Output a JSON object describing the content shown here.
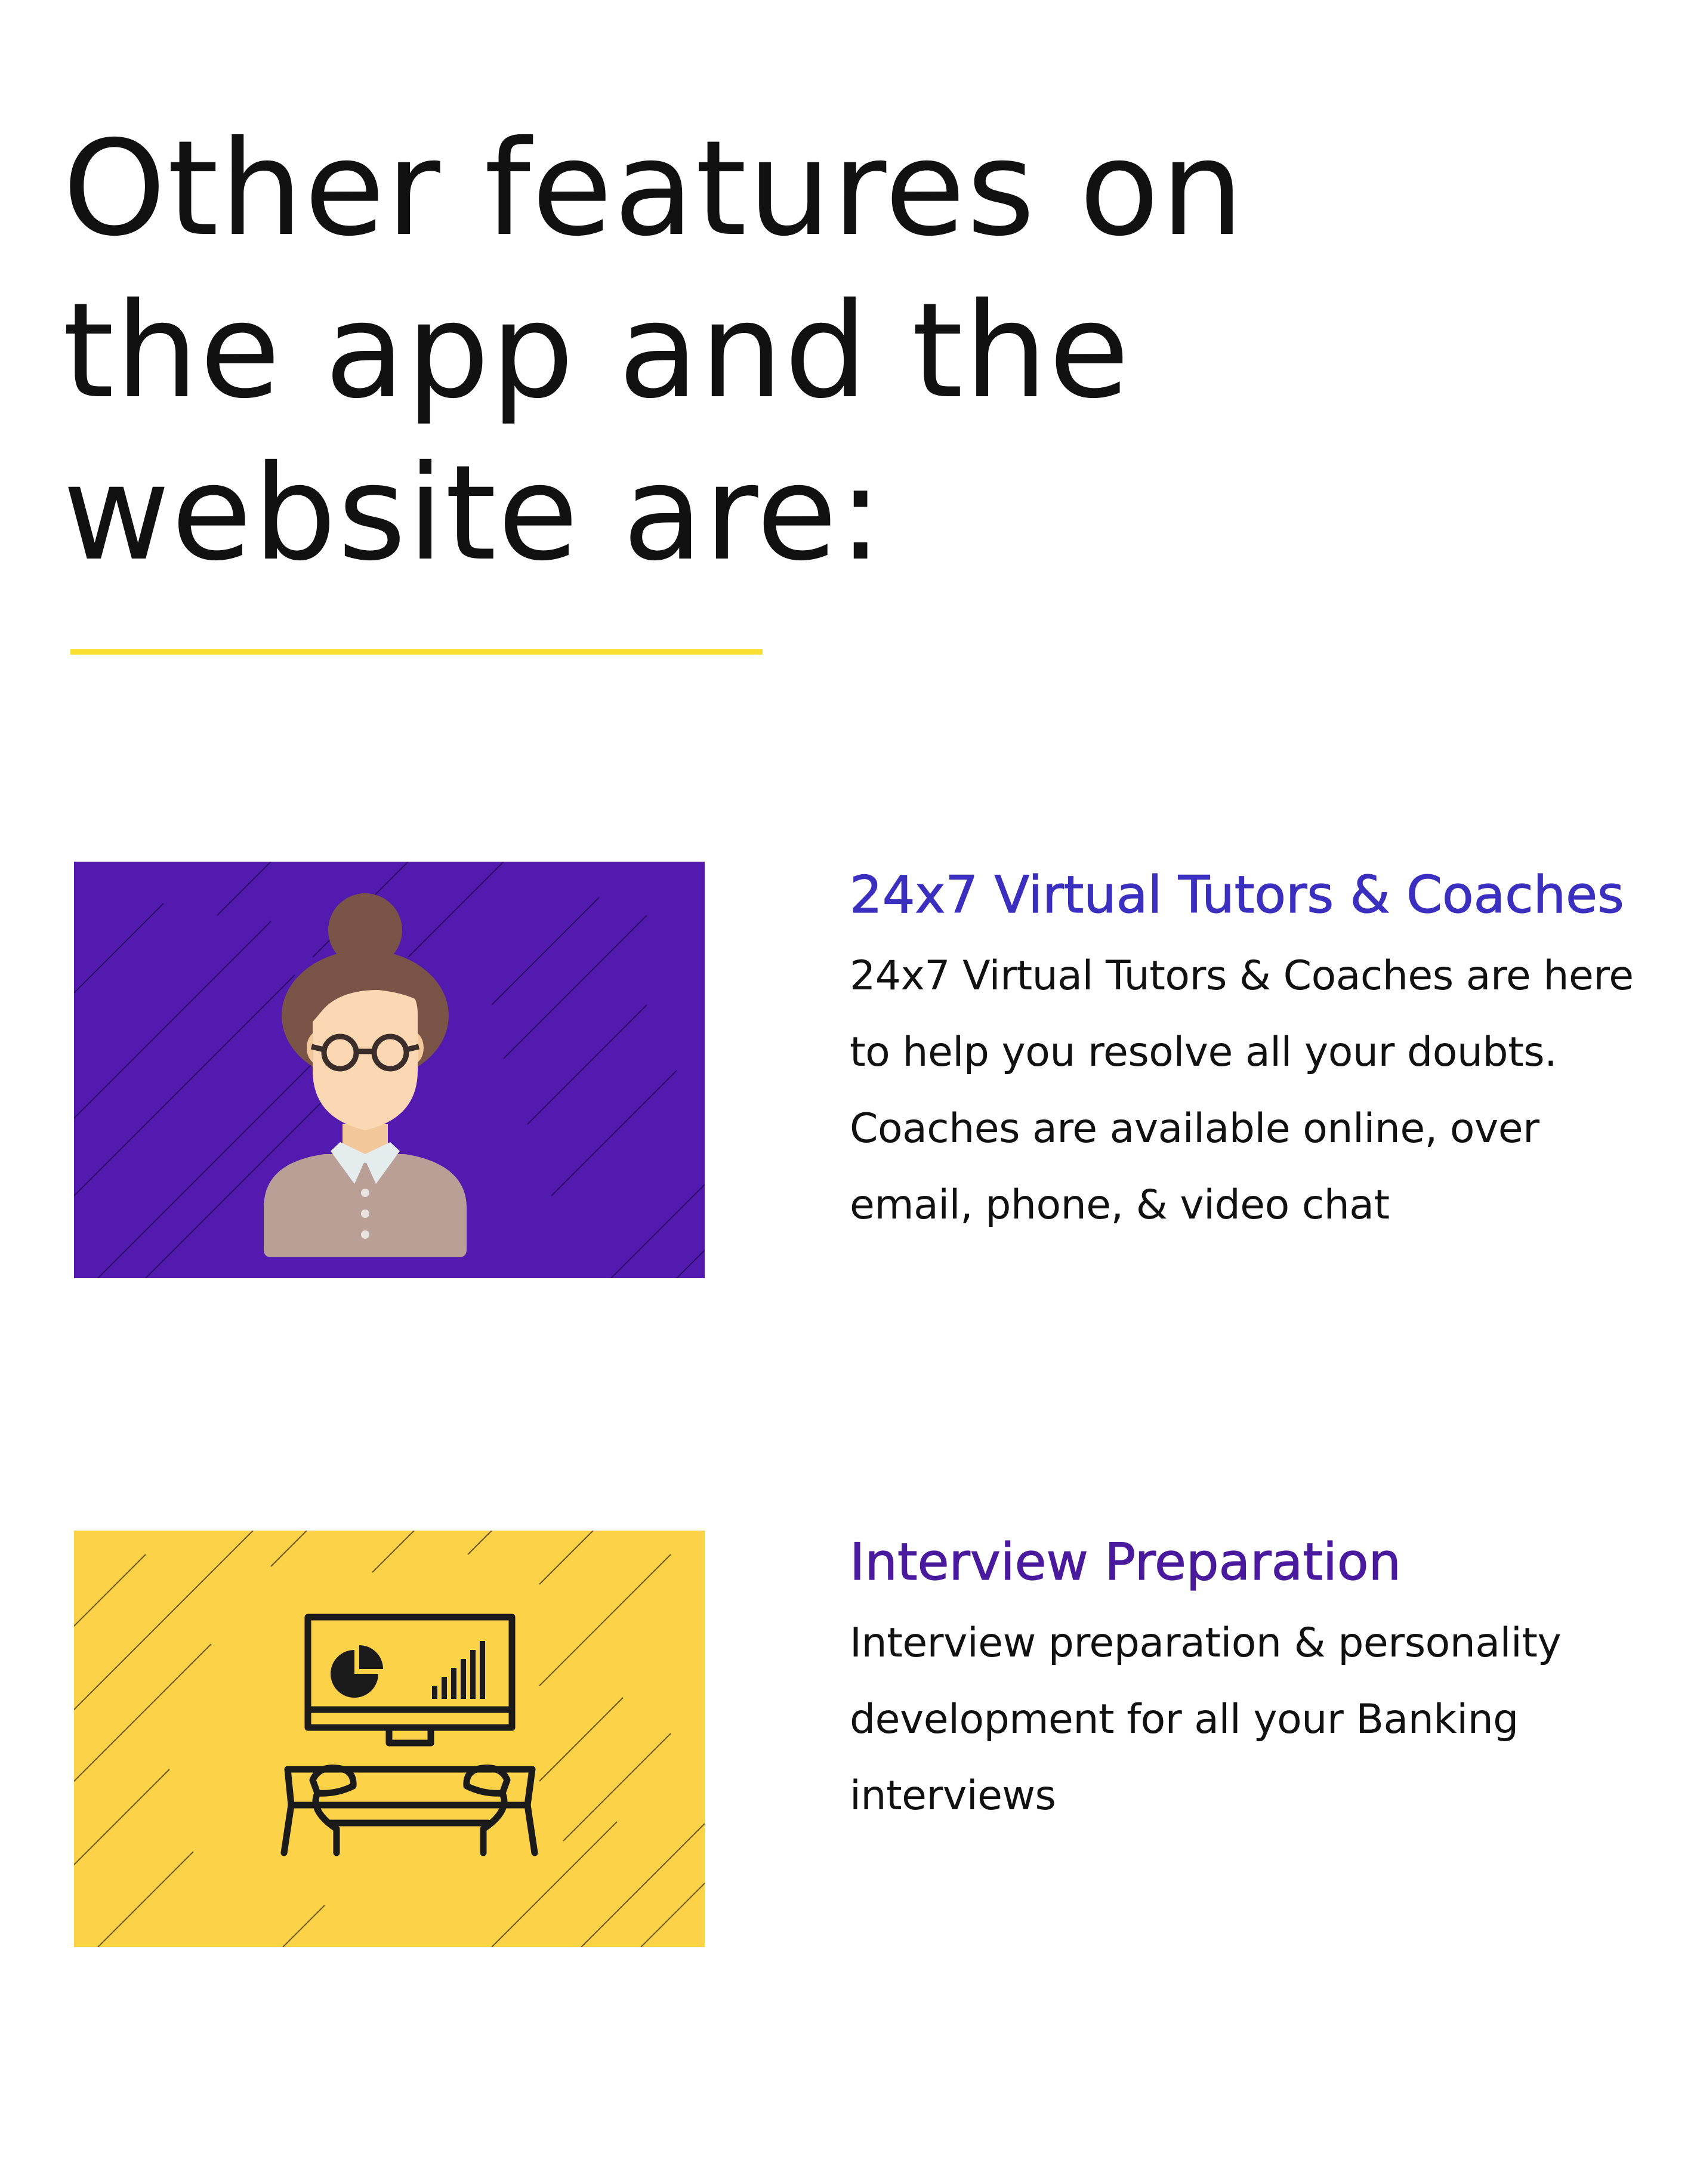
{
  "page": {
    "title": "Other features on the app and the website are:",
    "underline_color": "#f9e030"
  },
  "features": [
    {
      "heading": "24x7 Virtual Tutors & Coaches",
      "description": "24x7 Virtual Tutors & Coaches are here to help you resolve all your doubts. Coaches are available online, over email, phone, & video chat",
      "heading_color": "#3b2fc0",
      "image_background": "#521aaf",
      "icon": "tutor-avatar-icon"
    },
    {
      "heading": "Interview Preparation",
      "description": "Interview preparation & personality development for all your Banking interviews",
      "heading_color": "#4a1a9e",
      "image_background": "#fcd249",
      "icon": "computer-typing-icon"
    }
  ]
}
